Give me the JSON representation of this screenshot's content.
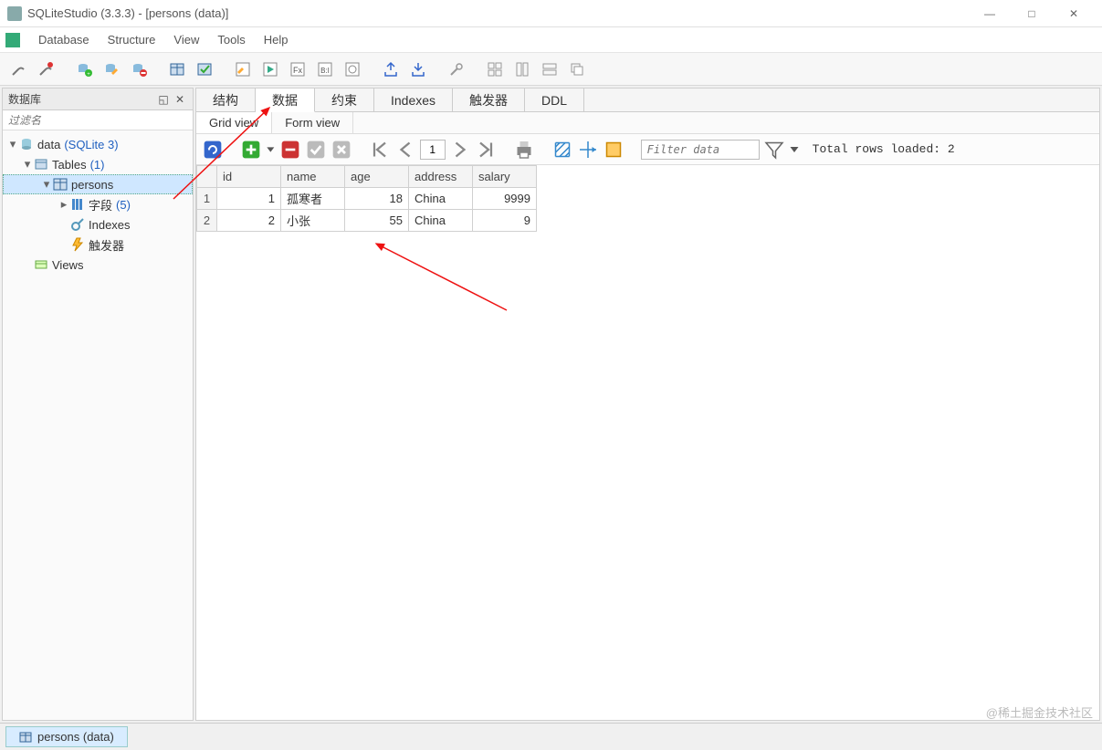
{
  "window": {
    "title": "SQLiteStudio (3.3.3) - [persons (data)]",
    "minimize": "—",
    "maximize": "□",
    "close": "✕"
  },
  "menubar": [
    "Database",
    "Structure",
    "View",
    "Tools",
    "Help"
  ],
  "left_panel": {
    "title": "数据库",
    "filter_placeholder": "过滤名"
  },
  "tree": {
    "db_name": "data",
    "db_type": "(SQLite 3)",
    "tables_label": "Tables",
    "tables_count": "(1)",
    "table_name": "persons",
    "fields_label": "字段",
    "fields_count": "(5)",
    "indexes_label": "Indexes",
    "triggers_label": "触发器",
    "views_label": "Views"
  },
  "tabs": [
    "结构",
    "数据",
    "约束",
    "Indexes",
    "触发器",
    "DDL"
  ],
  "active_tab_index": 1,
  "subtabs": [
    "Grid view",
    "Form view"
  ],
  "active_subtab_index": 0,
  "data_toolbar": {
    "page": "1",
    "filter_placeholder": "Filter data",
    "status": "Total rows loaded: 2"
  },
  "grid": {
    "columns": [
      "id",
      "name",
      "age",
      "address",
      "salary"
    ],
    "rows": [
      {
        "num": "1",
        "id": "1",
        "name": "孤寒者",
        "age": "18",
        "address": "China",
        "salary": "9999"
      },
      {
        "num": "2",
        "id": "2",
        "name": "小张",
        "age": "55",
        "address": "China",
        "salary": "9"
      }
    ]
  },
  "bottom_tab": "persons (data)",
  "watermark": "@稀土掘金技术社区"
}
